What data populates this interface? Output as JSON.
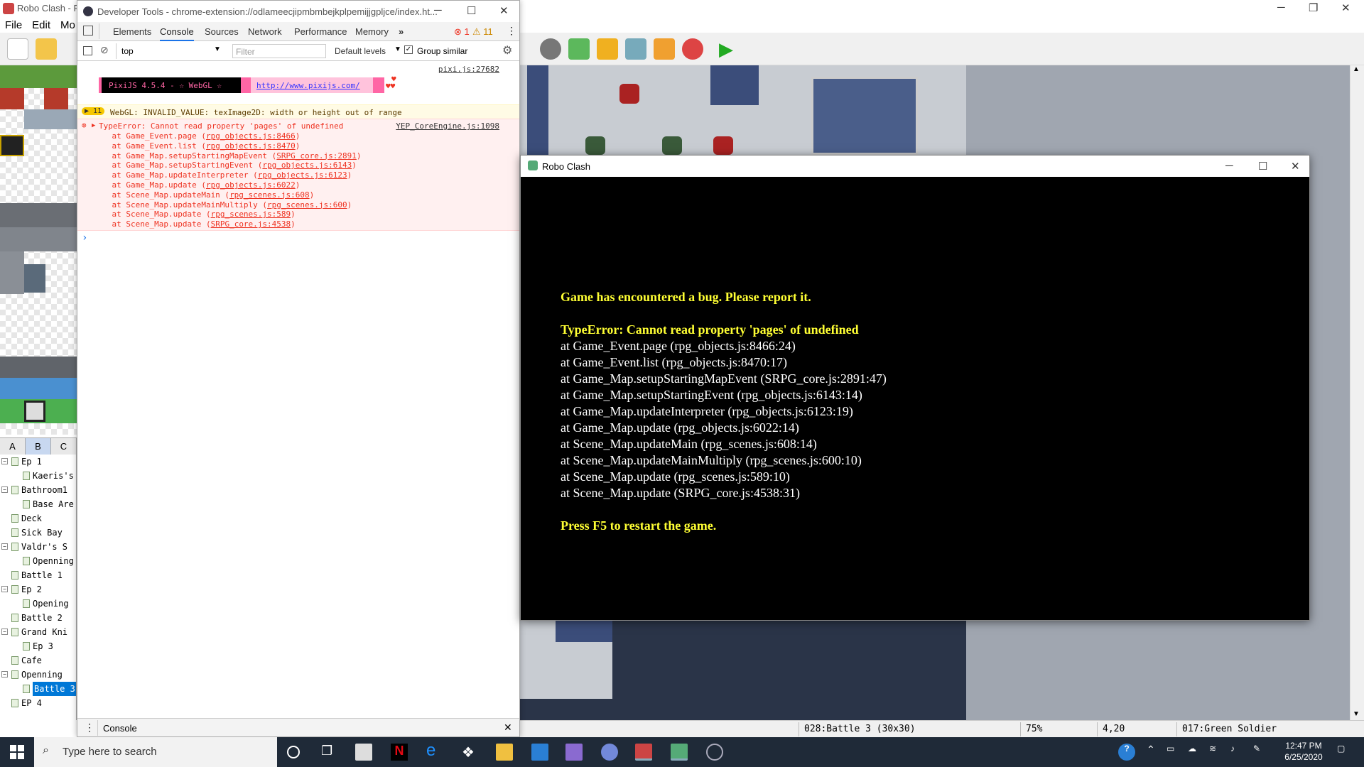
{
  "editor": {
    "title": "Robo Clash - RP",
    "menu": [
      "File",
      "Edit",
      "Mo"
    ],
    "tileset_tabs": [
      "A",
      "B",
      "C"
    ],
    "map_tree": [
      {
        "label": "Ep 1",
        "indent": 1,
        "expander": "⊟"
      },
      {
        "label": "Kaeris's",
        "indent": 2,
        "expander": ""
      },
      {
        "label": "Bathroom1",
        "indent": 1,
        "expander": "⊟"
      },
      {
        "label": "Base Are",
        "indent": 2,
        "expander": ""
      },
      {
        "label": "Deck",
        "indent": 1,
        "expander": ""
      },
      {
        "label": "Sick Bay",
        "indent": 1,
        "expander": ""
      },
      {
        "label": "Valdr's S",
        "indent": 1,
        "expander": "⊟"
      },
      {
        "label": "Openning",
        "indent": 2,
        "expander": ""
      },
      {
        "label": "Battle 1",
        "indent": 1,
        "expander": ""
      },
      {
        "label": "Ep 2",
        "indent": 1,
        "expander": "⊟"
      },
      {
        "label": "Opening",
        "indent": 2,
        "expander": ""
      },
      {
        "label": "Battle 2",
        "indent": 1,
        "expander": ""
      },
      {
        "label": "Grand Kni",
        "indent": 1,
        "expander": "⊟"
      },
      {
        "label": "Ep 3",
        "indent": 2,
        "expander": ""
      },
      {
        "label": "Cafe",
        "indent": 1,
        "expander": ""
      },
      {
        "label": "Openning",
        "indent": 1,
        "expander": "⊟"
      },
      {
        "label": "Battle 3",
        "indent": 2,
        "expander": "",
        "selected": true
      },
      {
        "label": "EP 4",
        "indent": 1,
        "expander": ""
      }
    ],
    "status": {
      "map": "028:Battle 3 (30x30)",
      "zoom": "75%",
      "coords": "4,20",
      "event": "017:Green Soldier"
    }
  },
  "devtools": {
    "title": "Developer Tools - chrome-extension://odlameecjipmbmbejkplpemijjgpljce/index.ht...",
    "tabs": [
      "Elements",
      "Console",
      "Sources",
      "Network",
      "Performance",
      "Memory"
    ],
    "more": "»",
    "error_count": "1",
    "warn_count": "11",
    "context": "top",
    "filter_placeholder": "Filter",
    "levels": "Default levels",
    "group_similar": "Group similar",
    "pixi_source": "pixi.js:27682",
    "pixi_banner": "PixiJS 4.5.4 - ☆ WebGL ☆",
    "pixi_url": "http://www.pixijs.com/",
    "warn_badge": "11",
    "warn_text": "WebGL: INVALID_VALUE: texImage2D: width or height out of range",
    "error_title": "TypeError: Cannot read property 'pages' of undefined",
    "error_source": "YEP_CoreEngine.js:1098",
    "stack": [
      {
        "fn": "    at Game_Event.page (",
        "loc": "rpg_objects.js:8466"
      },
      {
        "fn": "    at Game_Event.list (",
        "loc": "rpg_objects.js:8470"
      },
      {
        "fn": "    at Game_Map.setupStartingMapEvent (",
        "loc": "SRPG_core.js:2891"
      },
      {
        "fn": "    at Game_Map.setupStartingEvent (",
        "loc": "rpg_objects.js:6143"
      },
      {
        "fn": "    at Game_Map.updateInterpreter (",
        "loc": "rpg_objects.js:6123"
      },
      {
        "fn": "    at Game_Map.update (",
        "loc": "rpg_objects.js:6022"
      },
      {
        "fn": "    at Scene_Map.updateMain (",
        "loc": "rpg_scenes.js:608"
      },
      {
        "fn": "    at Scene_Map.updateMainMultiply (",
        "loc": "rpg_scenes.js:600"
      },
      {
        "fn": "    at Scene_Map.update (",
        "loc": "rpg_scenes.js:589"
      },
      {
        "fn": "    at Scene_Map.update (",
        "loc": "SRPG_core.js:4538"
      }
    ],
    "prompt": "›",
    "drawer_tab": "Console"
  },
  "game": {
    "title": "Robo Clash",
    "heading": "Game has encountered a bug. Please report it.",
    "error": "TypeError: Cannot read property 'pages' of undefined",
    "stack": [
      "at Game_Event.page (rpg_objects.js:8466:24)",
      "at Game_Event.list (rpg_objects.js:8470:17)",
      "at Game_Map.setupStartingMapEvent (SRPG_core.js:2891:47)",
      "at Game_Map.setupStartingEvent (rpg_objects.js:6143:14)",
      "at Game_Map.updateInterpreter (rpg_objects.js:6123:19)",
      "at Game_Map.update (rpg_objects.js:6022:14)",
      "at Scene_Map.updateMain (rpg_scenes.js:608:14)",
      "at Scene_Map.updateMainMultiply (rpg_scenes.js:600:10)",
      "at Scene_Map.update (rpg_scenes.js:589:10)",
      "at Scene_Map.update (SRPG_core.js:4538:31)"
    ],
    "footer": "Press F5 to restart the game."
  },
  "taskbar": {
    "search_placeholder": "Type here to search",
    "time": "12:47 PM",
    "date": "6/25/2020"
  },
  "colors": {
    "taskbar": "#1f2a38",
    "error_bg": "#fff0f0",
    "error_text": "#e32",
    "game_yellow": "#ffff33",
    "selection": "#0078d7"
  }
}
